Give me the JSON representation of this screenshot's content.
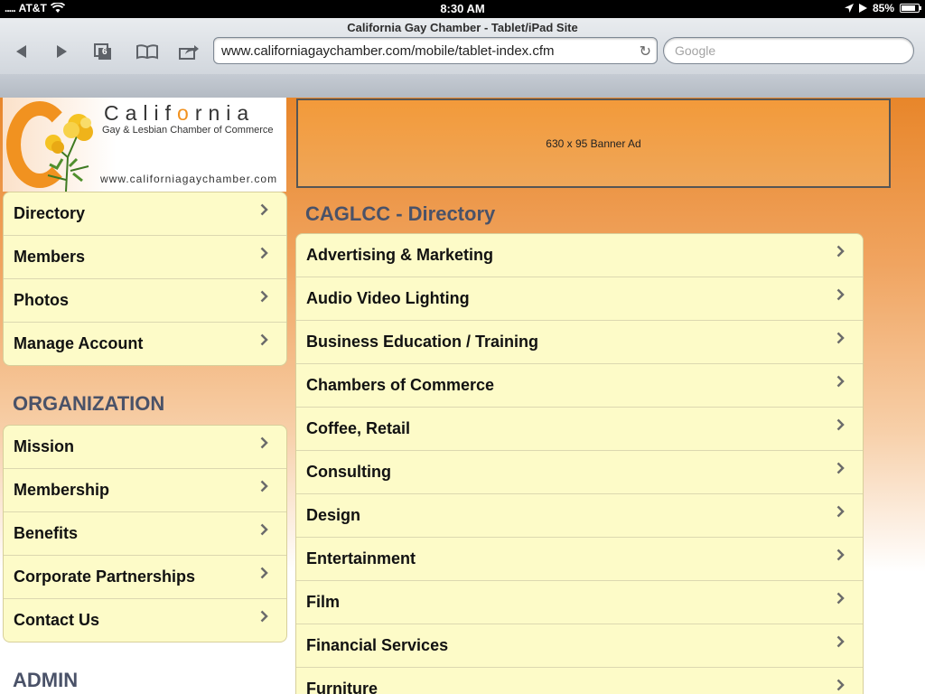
{
  "status": {
    "carrier": "AT&T",
    "time": "8:30 AM",
    "battery": "85%",
    "battery_level": 0.85
  },
  "browser": {
    "title": "California Gay Chamber - Tablet/iPad Site",
    "url": "www.californiagaychamber.com/mobile/tablet-index.cfm",
    "search_placeholder": "Google",
    "tab_count": "6"
  },
  "logo": {
    "brand_pre": "Calif",
    "brand_o": "o",
    "brand_post": "rnia",
    "tagline": "Gay & Lesbian Chamber of Commerce",
    "website": "www.californiagaychamber.com"
  },
  "banner": {
    "text": "630 x 95 Banner Ad"
  },
  "nav": {
    "items": [
      "Directory",
      "Members",
      "Photos",
      "Manage Account"
    ]
  },
  "organization": {
    "heading": "ORGANIZATION",
    "items": [
      "Mission",
      "Membership",
      "Benefits",
      "Corporate Partnerships",
      "Contact Us"
    ]
  },
  "admin": {
    "heading": "ADMIN"
  },
  "directory": {
    "heading": "CAGLCC - Directory",
    "items": [
      "Advertising & Marketing",
      "Audio Video Lighting",
      "Business Education / Training",
      "Chambers of Commerce",
      "Coffee, Retail",
      "Consulting",
      "Design",
      "Entertainment",
      "Film",
      "Financial Services",
      "Furniture"
    ]
  }
}
